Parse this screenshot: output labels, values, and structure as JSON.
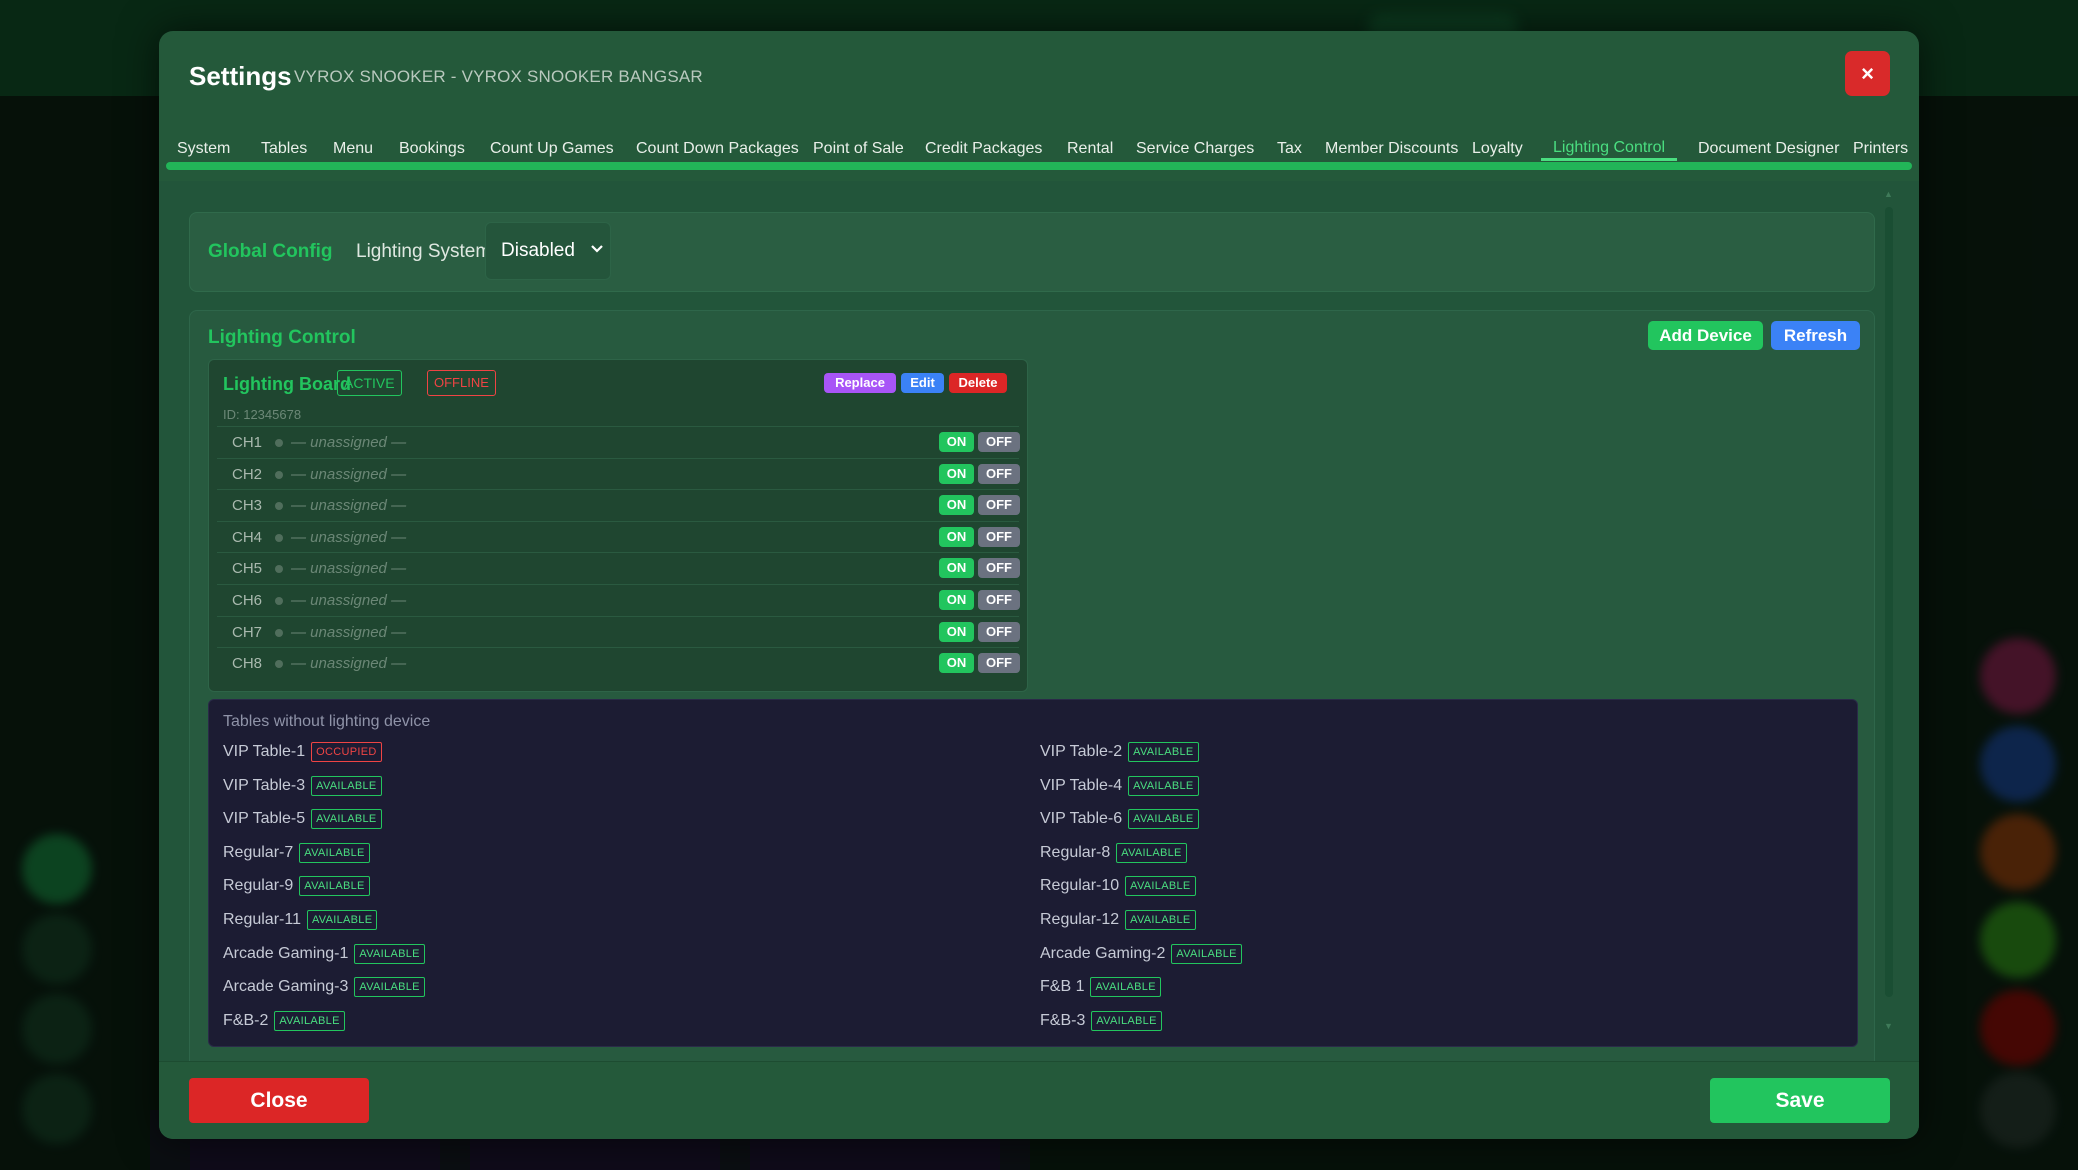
{
  "colors": {
    "accent": "#22c55e",
    "danger": "#dc2626",
    "info": "#3b82f6",
    "purple": "#a855f7"
  },
  "modal": {
    "title": "Settings",
    "subtitle": "VYROX SNOOKER - VYROX SNOOKER BANGSAR",
    "close_glyph": "×"
  },
  "tabs": [
    {
      "label": "System"
    },
    {
      "label": "Tables"
    },
    {
      "label": "Menu"
    },
    {
      "label": "Bookings"
    },
    {
      "label": "Count Up Games"
    },
    {
      "label": "Count Down Packages"
    },
    {
      "label": "Point of Sale"
    },
    {
      "label": "Credit Packages"
    },
    {
      "label": "Rental"
    },
    {
      "label": "Service Charges"
    },
    {
      "label": "Tax"
    },
    {
      "label": "Member Discounts"
    },
    {
      "label": "Loyalty"
    },
    {
      "label": "Lighting Control",
      "active": true
    },
    {
      "label": "Document Designer"
    },
    {
      "label": "Printers"
    }
  ],
  "global_config": {
    "label": "Global Config",
    "system_label": "Lighting System",
    "selected": "Disabled",
    "chevron": "⌄"
  },
  "lighting_control": {
    "title": "Lighting Control",
    "add_device": "Add Device",
    "refresh": "Refresh",
    "board": {
      "name": "Lighting Board",
      "status_active": "ACTIVE",
      "status_offline": "OFFLINE",
      "replace": "Replace",
      "edit": "Edit",
      "delete": "Delete",
      "id_text": "ID: 12345678",
      "channels": [
        {
          "label": "CH1",
          "assignment": "— unassigned —",
          "on": "ON",
          "off": "OFF"
        },
        {
          "label": "CH2",
          "assignment": "— unassigned —",
          "on": "ON",
          "off": "OFF"
        },
        {
          "label": "CH3",
          "assignment": "— unassigned —",
          "on": "ON",
          "off": "OFF"
        },
        {
          "label": "CH4",
          "assignment": "— unassigned —",
          "on": "ON",
          "off": "OFF"
        },
        {
          "label": "CH5",
          "assignment": "— unassigned —",
          "on": "ON",
          "off": "OFF"
        },
        {
          "label": "CH6",
          "assignment": "— unassigned —",
          "on": "ON",
          "off": "OFF"
        },
        {
          "label": "CH7",
          "assignment": "— unassigned —",
          "on": "ON",
          "off": "OFF"
        },
        {
          "label": "CH8",
          "assignment": "— unassigned —",
          "on": "ON",
          "off": "OFF"
        }
      ]
    },
    "tables_without_device": {
      "title": "Tables without lighting device",
      "items": [
        {
          "name": "VIP Table-1",
          "status": "OCCUPIED"
        },
        {
          "name": "VIP Table-2",
          "status": "AVAILABLE"
        },
        {
          "name": "VIP Table-3",
          "status": "AVAILABLE"
        },
        {
          "name": "VIP Table-4",
          "status": "AVAILABLE"
        },
        {
          "name": "VIP Table-5",
          "status": "AVAILABLE"
        },
        {
          "name": "VIP Table-6",
          "status": "AVAILABLE"
        },
        {
          "name": "Regular-7",
          "status": "AVAILABLE"
        },
        {
          "name": "Regular-8",
          "status": "AVAILABLE"
        },
        {
          "name": "Regular-9",
          "status": "AVAILABLE"
        },
        {
          "name": "Regular-10",
          "status": "AVAILABLE"
        },
        {
          "name": "Regular-11",
          "status": "AVAILABLE"
        },
        {
          "name": "Regular-12",
          "status": "AVAILABLE"
        },
        {
          "name": "Arcade Gaming-1",
          "status": "AVAILABLE"
        },
        {
          "name": "Arcade Gaming-2",
          "status": "AVAILABLE"
        },
        {
          "name": "Arcade Gaming-3",
          "status": "AVAILABLE"
        },
        {
          "name": "F&B 1",
          "status": "AVAILABLE"
        },
        {
          "name": "F&B-2",
          "status": "AVAILABLE"
        },
        {
          "name": "F&B-3",
          "status": "AVAILABLE"
        }
      ]
    }
  },
  "footer": {
    "close": "Close",
    "save": "Save"
  }
}
